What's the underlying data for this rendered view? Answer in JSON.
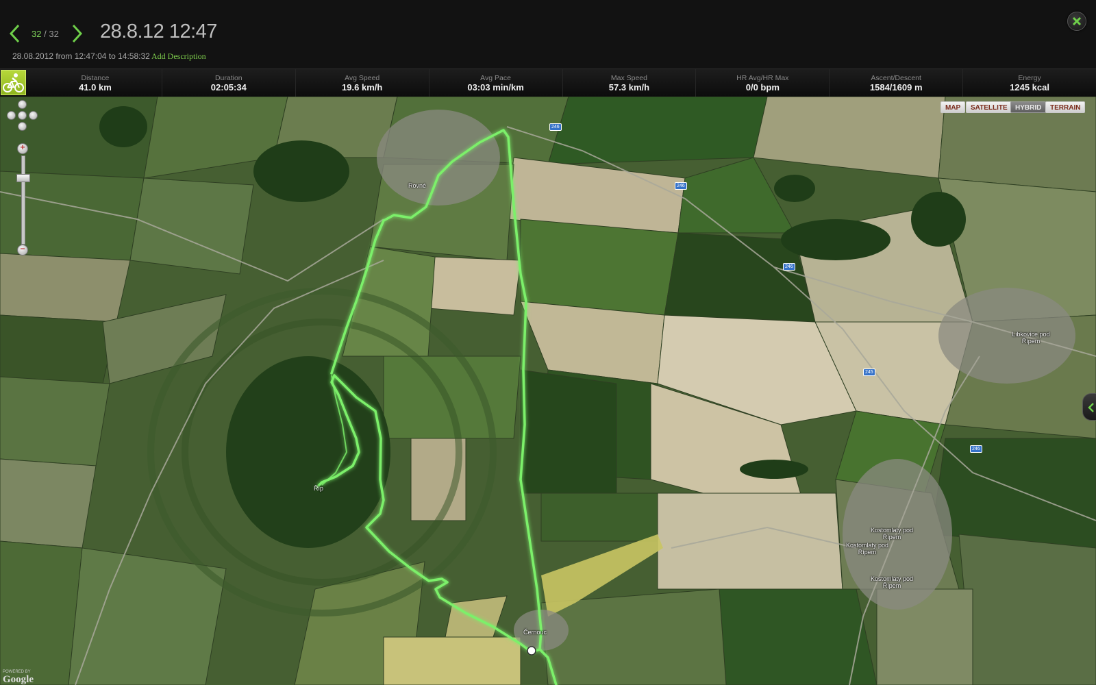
{
  "header": {
    "current_index": "32",
    "separator": "/",
    "total": "32",
    "title": "28.8.12 12:47",
    "date_line": "28.08.2012 from 12:47:04 to 14:58:32",
    "add_description": "Add Description"
  },
  "stats": [
    {
      "label": "Distance",
      "value": "41.0 km"
    },
    {
      "label": "Duration",
      "value": "02:05:34"
    },
    {
      "label": "Avg Speed",
      "value": "19.6 km/h"
    },
    {
      "label": "Avg Pace",
      "value": "03:03 min/km"
    },
    {
      "label": "Max Speed",
      "value": "57.3 km/h"
    },
    {
      "label": "HR Avg/HR Max",
      "value": "0/0 bpm"
    },
    {
      "label": "Ascent/Descent",
      "value": "1584/1609 m"
    },
    {
      "label": "Energy",
      "value": "1245 kcal"
    }
  ],
  "map": {
    "type_buttons": [
      {
        "label": "MAP",
        "active": false
      },
      {
        "label": "SATELLITE",
        "active": false
      },
      {
        "label": "HYBRID",
        "active": true
      },
      {
        "label": "TERRAIN",
        "active": false
      }
    ],
    "place_labels": {
      "rovne": "Rovné",
      "rip": "Říp",
      "libkovice": "Libkovice pod Řípem",
      "kostomlaty_1": "Kostomlaty pod Řípem",
      "kostomlaty_2": "Kostomlaty pod Řípem",
      "kostomlaty_3": "Kostomlaty pod Řípem",
      "cernouc": "Černouc"
    },
    "road_numbers": {
      "r1": "246",
      "r2": "246",
      "r3": "246",
      "r4": "245",
      "r5": "246"
    },
    "attribution_small": "POWERED BY",
    "attribution": "Google"
  },
  "colors": {
    "accent": "#7fd45a",
    "route": "#7cf06a",
    "sport_icon": "#a6c82e"
  },
  "icons": {
    "sport": "cycling-icon",
    "close": "close-x-icon",
    "prev": "chevron-left-icon",
    "next": "chevron-right-icon"
  }
}
